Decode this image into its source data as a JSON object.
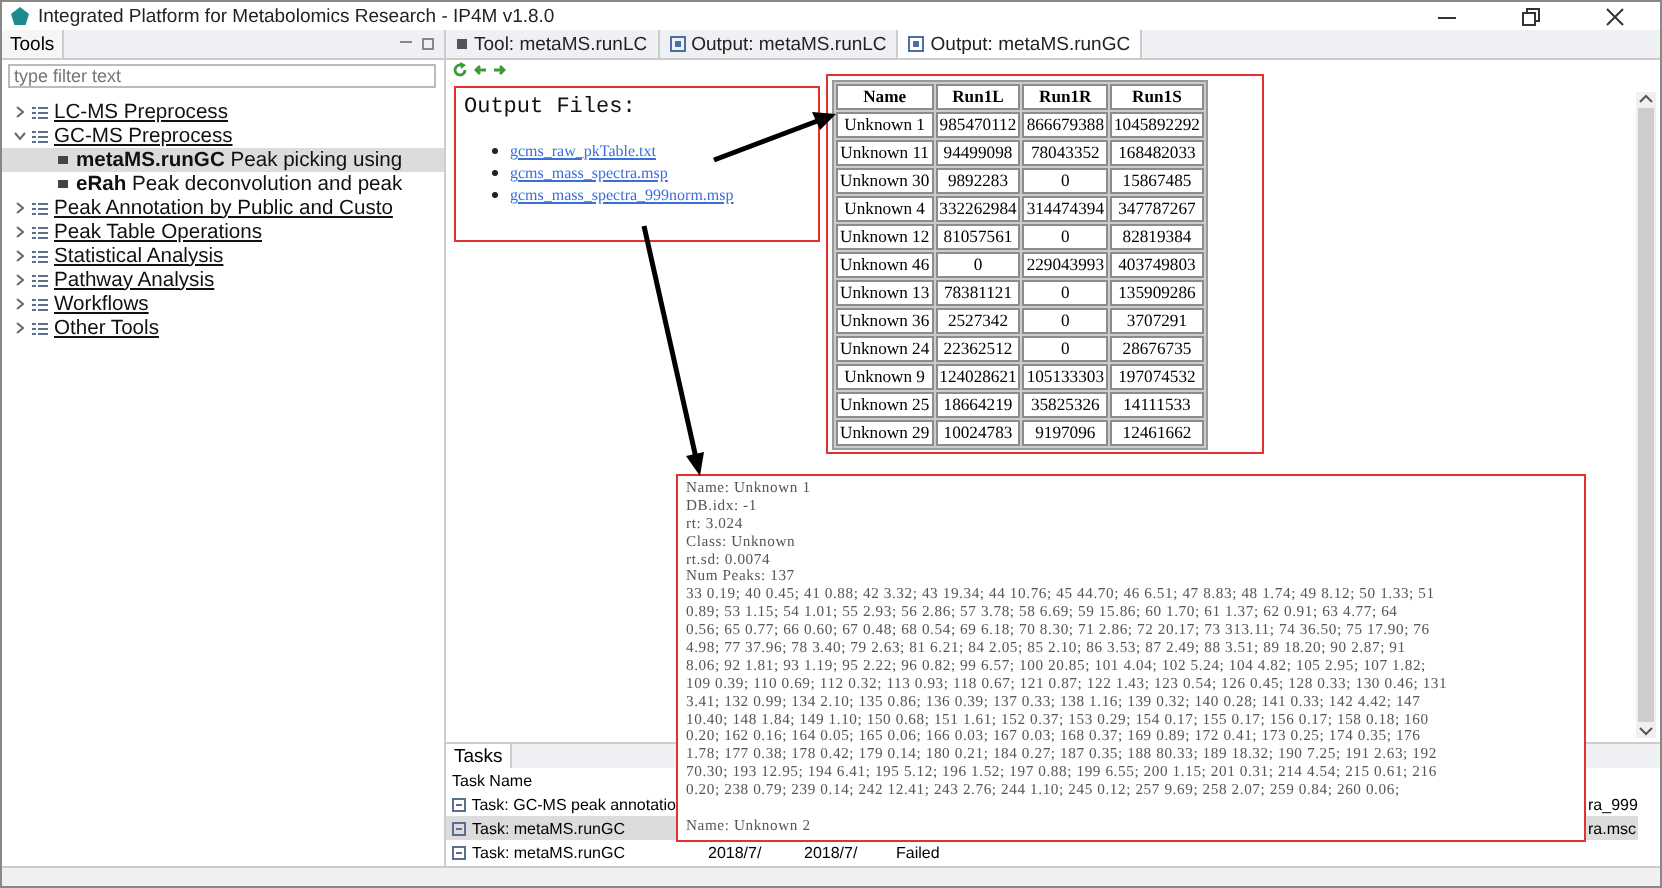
{
  "window": {
    "title": "Integrated Platform for Metabolomics Research - IP4M v1.8.0"
  },
  "tools_panel": {
    "title": "Tools",
    "filter": {
      "placeholder": "type filter text"
    },
    "tree": [
      {
        "label": "LC-MS Preprocess",
        "expanded": false
      },
      {
        "label": "GC-MS Preprocess",
        "expanded": true,
        "children": [
          {
            "label": "**metaMS.runGC** Peak picking using",
            "selected": true
          },
          {
            "label": "**eRah** Peak deconvolution and peak",
            "selected": false
          }
        ]
      },
      {
        "label": "Peak Annotation by Public and Custo",
        "expanded": false
      },
      {
        "label": "Peak Table Operations",
        "expanded": false
      },
      {
        "label": "Statistical Analysis",
        "expanded": false
      },
      {
        "label": "Pathway Analysis",
        "expanded": false
      },
      {
        "label": "Workflows",
        "expanded": false
      },
      {
        "label": "Other Tools",
        "expanded": false
      }
    ]
  },
  "editor": {
    "tabs": [
      {
        "label": "Tool: metaMS.runLC",
        "kind": "tool",
        "selected": false
      },
      {
        "label": "Output: metaMS.runLC",
        "kind": "output",
        "selected": false
      },
      {
        "label": "Output: metaMS.runGC",
        "kind": "output",
        "selected": true
      }
    ]
  },
  "output_files": {
    "heading": "Output Files:",
    "links": [
      "gcms_raw_pkTable.txt",
      "gcms_mass_spectra.msp",
      "gcms_mass_spectra_999norm.msp"
    ]
  },
  "results_table": {
    "columns": [
      "Name",
      "Run1L",
      "Run1R",
      "Run1S"
    ],
    "rows": [
      [
        "Unknown 1",
        "985470112",
        "866679388",
        "1045892292"
      ],
      [
        "Unknown 11",
        "94499098",
        "78043352",
        "168482033"
      ],
      [
        "Unknown 30",
        "9892283",
        "0",
        "15867485"
      ],
      [
        "Unknown 4",
        "332262984",
        "314474394",
        "347787267"
      ],
      [
        "Unknown 12",
        "81057561",
        "0",
        "82819384"
      ],
      [
        "Unknown 46",
        "0",
        "229043993",
        "403749803"
      ],
      [
        "Unknown 13",
        "78381121",
        "0",
        "135909286"
      ],
      [
        "Unknown 36",
        "2527342",
        "0",
        "3707291"
      ],
      [
        "Unknown 24",
        "22362512",
        "0",
        "28676735"
      ],
      [
        "Unknown 9",
        "124028621",
        "105133303",
        "197074532"
      ],
      [
        "Unknown 25",
        "18664219",
        "35825326",
        "14111533"
      ],
      [
        "Unknown 29",
        "10024783",
        "9197096",
        "12461662"
      ]
    ]
  },
  "spectrum_text": {
    "header_lines": [
      "Name: Unknown 1",
      "DB.idx: -1",
      "rt: 3.024",
      "Class: Unknown",
      "rt.sd: 0.0074",
      "Num Peaks: 137"
    ],
    "peak_lines": [
      "33 0.19; 40 0.45; 41 0.88; 42 3.32; 43 19.34; 44 10.76; 45 44.70; 46 6.51; 47 8.83; 48 1.74; 49 8.12; 50 1.33; 51",
      "0.89; 53 1.15; 54 1.01; 55 2.93; 56 2.86; 57 3.78; 58 6.69; 59 15.86; 60 1.70; 61 1.37; 62 0.91; 63 4.77; 64",
      "0.56; 65 0.77; 66 0.60; 67 0.48; 68 0.54; 69 6.18; 70 8.30; 71 2.86; 72 20.17; 73 313.11; 74 36.50; 75 17.90; 76",
      "4.98; 77 37.96; 78 3.40; 79 2.63; 81 6.21; 84 2.05; 85 2.10; 86 3.53; 87 2.49; 88 3.51; 89 18.20; 90 2.87; 91",
      "8.06; 92 1.81; 93 1.19; 95 2.22; 96 0.82; 99 6.57; 100 20.85; 101 4.04; 102 5.24; 104 4.82; 105 2.95; 107 1.82;",
      "109 0.39; 110 0.69; 112 0.32; 113 0.93; 118 0.67; 121 0.87; 122 1.43; 123 0.54; 126 0.45; 128 0.33; 130 0.46; 131",
      "3.41; 132 0.99; 134 2.10; 135 0.86; 136 0.39; 137 0.33; 138 1.16; 139 0.32; 140 0.28; 141 0.33; 142 4.42; 147",
      "10.40; 148 1.84; 149 1.10; 150 0.68; 151 1.61; 152 0.37; 153 0.29; 154 0.17; 155 0.17; 156 0.17; 158 0.18; 160",
      "0.20; 162 0.16; 164 0.05; 165 0.06; 166 0.03; 167 0.03; 168 0.37; 169 0.89; 172 0.41; 173 0.25; 174 0.35; 176",
      "1.78; 177 0.38; 178 0.42; 179 0.14; 180 0.21; 184 0.27; 187 0.35; 188 80.33; 189 18.32; 190 7.25; 191 2.63; 192",
      "70.30; 193 12.95; 194 6.41; 195 5.12; 196 1.52; 197 0.88; 199 6.55; 200 1.15; 201 0.31; 214 4.54; 215 0.61; 216",
      "0.20; 238 0.79; 239 0.14; 242 12.41; 243 2.76; 244 1.10; 245 0.12; 257 9.69; 258 2.07; 259 0.84; 260 0.06;"
    ],
    "next_entry": "Name: Unknown 2"
  },
  "tasks": {
    "title": "Tasks",
    "columns": [
      "Task Name"
    ],
    "rows": [
      {
        "name": "Task: GC-MS peak annotatio",
        "column_5": "ra_999",
        "selected": false
      },
      {
        "name": "Task: metaMS.runGC",
        "column_5": "ra.msc",
        "selected": true
      },
      {
        "name": "Task: metaMS.runGC",
        "start": "2018/7/",
        "end": "2018/7/",
        "status": "Failed",
        "selected": false
      }
    ]
  }
}
